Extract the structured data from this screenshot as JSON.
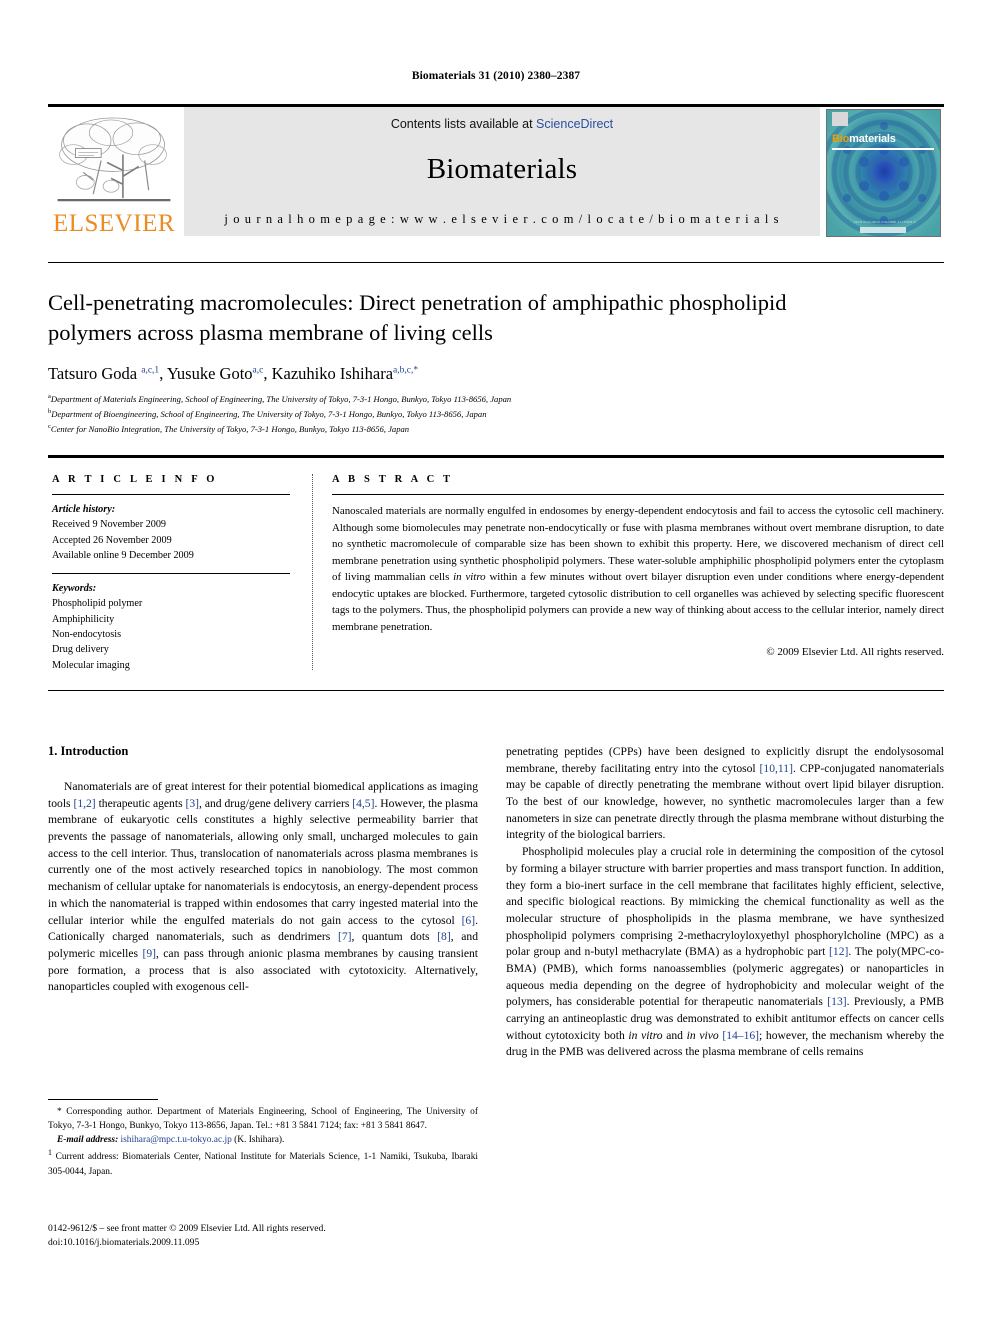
{
  "running_head": "Biomaterials 31 (2010) 2380–2387",
  "masthead": {
    "publisher_logo_text": "ELSEVIER",
    "contents_prefix": "Contents lists available at ",
    "contents_link": "ScienceDirect",
    "journal_name": "Biomaterials",
    "homepage_line": "j o u r n a l   h o m e p a g e :   w w w . e l s e v i e r . c o m / l o c a t e / b i o m a t e r i a l s",
    "cover": {
      "title_first": "Bio",
      "title_rest": "materials",
      "bottom_text": "ISSN 0142-9612  VOLUME 31  ISSUE 9"
    }
  },
  "article": {
    "title": "Cell-penetrating macromolecules: Direct penetration of amphipathic phospholipid polymers across plasma membrane of living cells",
    "authors": [
      {
        "name": "Tatsuro Goda ",
        "sup": "a,c,1",
        "sep": ", "
      },
      {
        "name": "Yusuke Goto",
        "sup": "a,c",
        "sep": ", "
      },
      {
        "name": "Kazuhiko Ishihara",
        "sup": "a,b,c,*",
        "sep": ""
      }
    ],
    "affiliations": [
      {
        "mark": "a",
        "text": "Department of Materials Engineering, School of Engineering, The University of Tokyo, 7-3-1 Hongo, Bunkyo, Tokyo 113-8656, Japan"
      },
      {
        "mark": "b",
        "text": "Department of Bioengineering, School of Engineering, The University of Tokyo, 7-3-1 Hongo, Bunkyo, Tokyo 113-8656, Japan"
      },
      {
        "mark": "c",
        "text": "Center for NanoBio Integration, The University of Tokyo, 7-3-1 Hongo, Bunkyo, Tokyo 113-8656, Japan"
      }
    ]
  },
  "info": {
    "heading": "A R T I C L E   I N F O",
    "history_label": "Article history:",
    "history": [
      "Received 9 November 2009",
      "Accepted 26 November 2009",
      "Available online 9 December 2009"
    ],
    "keywords_label": "Keywords:",
    "keywords": [
      "Phospholipid polymer",
      "Amphiphilicity",
      "Non-endocytosis",
      "Drug delivery",
      "Molecular imaging"
    ]
  },
  "abstract": {
    "heading": "A B S T R A C T",
    "body_1": "Nanoscaled materials are normally engulfed in endosomes by energy-dependent endocytosis and fail to access the cytosolic cell machinery. Although some biomolecules may penetrate non-endocytically or fuse with plasma membranes without overt membrane disruption, to date no synthetic macromolecule of comparable size has been shown to exhibit this property. Here, we discovered mechanism of direct cell membrane penetration using synthetic phospholipid polymers. These water-soluble amphiphilic phospholipid polymers enter the cytoplasm of living mammalian cells ",
    "italic_1": "in vitro",
    "body_2": " within a few minutes without overt bilayer disruption even under conditions where energy-dependent endocytic uptakes are blocked. Furthermore, targeted cytosolic distribution to cell organelles was achieved by selecting specific fluorescent tags to the polymers. Thus, the phospholipid polymers can provide a new way of thinking about access to the cellular interior, namely direct membrane penetration.",
    "copyright": "© 2009 Elsevier Ltd. All rights reserved."
  },
  "body": {
    "section_heading": "1. Introduction",
    "left_paragraphs": [
      {
        "indent": true,
        "runs": [
          {
            "t": "Nanomaterials are of great interest for their potential biomedical applications as imaging tools ",
            "k": "n"
          },
          {
            "t": "[1,2]",
            "k": "r"
          },
          {
            "t": " therapeutic agents ",
            "k": "n"
          },
          {
            "t": "[3]",
            "k": "r"
          },
          {
            "t": ", and drug/gene delivery carriers ",
            "k": "n"
          },
          {
            "t": "[4,5]",
            "k": "r"
          },
          {
            "t": ". However, the plasma membrane of eukaryotic cells constitutes a highly selective permeability barrier that prevents the passage of nanomaterials, allowing only small, uncharged molecules to gain access to the cell interior. Thus, translocation of nanomaterials across plasma membranes is currently one of the most actively researched topics in nanobiology. The most common mechanism of cellular uptake for nanomaterials is endocytosis, an energy-dependent process in which the nanomaterial is trapped within endosomes that carry ingested material into the cellular interior while the engulfed materials do not gain access to the cytosol ",
            "k": "n"
          },
          {
            "t": "[6]",
            "k": "r"
          },
          {
            "t": ". Cationically charged nanomaterials, such as dendrimers ",
            "k": "n"
          },
          {
            "t": "[7]",
            "k": "r"
          },
          {
            "t": ", quantum dots ",
            "k": "n"
          },
          {
            "t": "[8]",
            "k": "r"
          },
          {
            "t": ", and polymeric micelles ",
            "k": "n"
          },
          {
            "t": "[9]",
            "k": "r"
          },
          {
            "t": ", can pass through anionic plasma membranes by causing transient pore formation, a process that is also associated with cytotoxicity. Alternatively, nanoparticles coupled with exogenous cell-",
            "k": "n"
          }
        ]
      }
    ],
    "right_paragraphs": [
      {
        "indent": false,
        "runs": [
          {
            "t": "penetrating peptides (CPPs) have been designed to explicitly disrupt the endolysosomal membrane, thereby facilitating entry into the cytosol ",
            "k": "n"
          },
          {
            "t": "[10,11]",
            "k": "r"
          },
          {
            "t": ". CPP-conjugated nanomaterials may be capable of directly penetrating the membrane without overt lipid bilayer disruption. To the best of our knowledge, however, no synthetic macromolecules larger than a few nanometers in size can penetrate directly through the plasma membrane without disturbing the integrity of the biological barriers.",
            "k": "n"
          }
        ]
      },
      {
        "indent": true,
        "runs": [
          {
            "t": "Phospholipid molecules play a crucial role in determining the composition of the cytosol by forming a bilayer structure with barrier properties and mass transport function. In addition, they form a bio-inert surface in the cell membrane that facilitates highly efficient, selective, and specific biological reactions. By mimicking the chemical functionality as well as the molecular structure of phospholipids in the plasma membrane, we have synthesized phospholipid polymers comprising 2-methacryloyloxyethyl phosphorylcholine (MPC) as a polar group and n-butyl methacrylate (BMA) as a hydrophobic part ",
            "k": "n"
          },
          {
            "t": "[12]",
            "k": "r"
          },
          {
            "t": ". The poly(MPC-co-BMA) (PMB), which forms nanoassemblies (polymeric aggregates) or nanoparticles in aqueous media depending on the degree of hydrophobicity and molecular weight of the polymers, has considerable potential for therapeutic nanomaterials ",
            "k": "n"
          },
          {
            "t": "[13]",
            "k": "r"
          },
          {
            "t": ". Previously, a PMB carrying an antineoplastic drug was demonstrated to exhibit antitumor effects on cancer cells without cytotoxicity both ",
            "k": "n"
          },
          {
            "t": "in vitro",
            "k": "i"
          },
          {
            "t": " and ",
            "k": "n"
          },
          {
            "t": "in vivo",
            "k": "i"
          },
          {
            "t": " ",
            "k": "n"
          },
          {
            "t": "[14–16]",
            "k": "r"
          },
          {
            "t": "; however, the mechanism whereby the drug in the PMB was delivered across the plasma membrane of cells remains",
            "k": "n"
          }
        ]
      }
    ]
  },
  "footnotes": {
    "corresponding": "* Corresponding author. Department of Materials Engineering, School of Engineering, The University of Tokyo, 7-3-1 Hongo, Bunkyo, Tokyo 113-8656, Japan. Tel.: +81 3 5841 7124; fax: +81 3 5841 8647.",
    "email_label": "E-mail address:",
    "email_address": "ishihara@mpc.t.u-tokyo.ac.jp",
    "email_suffix": " (K. Ishihara).",
    "current_address_mark": "1",
    "current_address": "Current address: Biomaterials Center, National Institute for Materials Science, 1-1 Namiki, Tsukuba, Ibaraki 305-0044, Japan."
  },
  "imprint": {
    "line1": "0142-9612/$ – see front matter © 2009 Elsevier Ltd. All rights reserved.",
    "line2": "doi:10.1016/j.biomaterials.2009.11.095"
  },
  "colors": {
    "link_blue": "#2b4f9e",
    "ref_blue": "#1f3f8f",
    "elsevier_orange": "#ea8b24",
    "band_gray": "#e6e6e6",
    "cover_teal": "#3fa0a8"
  }
}
